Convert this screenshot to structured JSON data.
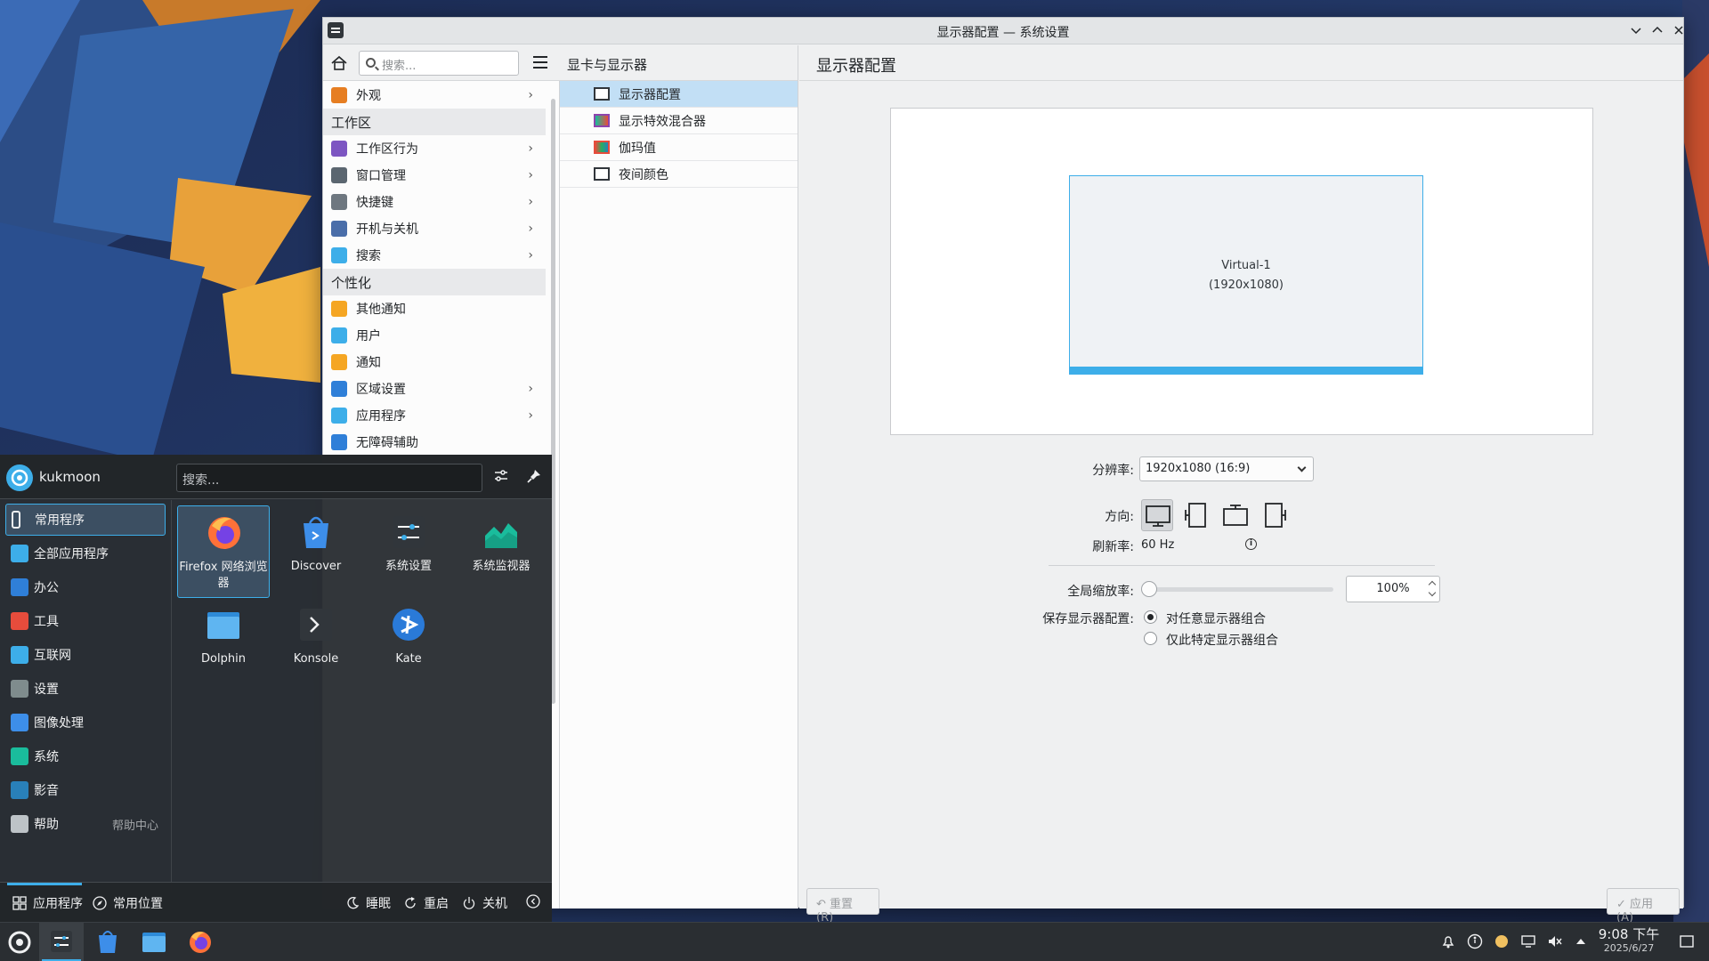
{
  "window": {
    "title": "显示器配置 — 系统设置",
    "search_placeholder": "搜索...",
    "sidebar": {
      "items": [
        {
          "type": "item",
          "label": "外观",
          "chevron": true,
          "color": "#e67e22"
        },
        {
          "type": "section",
          "label": "工作区"
        },
        {
          "type": "item",
          "label": "工作区行为",
          "chevron": true,
          "color": "#7d56c2"
        },
        {
          "type": "item",
          "label": "窗口管理",
          "chevron": true,
          "color": "#5b6670"
        },
        {
          "type": "item",
          "label": "快捷键",
          "chevron": true,
          "color": "#6e7780"
        },
        {
          "type": "item",
          "label": "开机与关机",
          "chevron": true,
          "color": "#4a6ea9"
        },
        {
          "type": "item",
          "label": "搜索",
          "chevron": true,
          "color": "#3daee9"
        },
        {
          "type": "section",
          "label": "个性化"
        },
        {
          "type": "item",
          "label": "其他通知",
          "chevron": false,
          "color": "#f5a623"
        },
        {
          "type": "item",
          "label": "用户",
          "chevron": false,
          "color": "#3daee9"
        },
        {
          "type": "item",
          "label": "通知",
          "chevron": false,
          "color": "#f5a623"
        },
        {
          "type": "item",
          "label": "区域设置",
          "chevron": true,
          "color": "#2f7fd8"
        },
        {
          "type": "item",
          "label": "应用程序",
          "chevron": true,
          "color": "#3daee9"
        },
        {
          "type": "item",
          "label": "无障碍辅助",
          "chevron": false,
          "color": "#2f7fd8"
        }
      ]
    },
    "sub": {
      "header": "显卡与显示器",
      "items": [
        {
          "label": "显示器配置",
          "active": true
        },
        {
          "label": "显示特效混合器",
          "active": false
        },
        {
          "label": "伽玛值",
          "active": false
        },
        {
          "label": "夜间颜色",
          "active": false
        }
      ]
    },
    "content": {
      "header": "显示器配置",
      "monitor_name": "Virtual-1",
      "monitor_res": "(1920x1080)",
      "resolution_label": "分辨率:",
      "resolution_value": "1920x1080 (16:9)",
      "orientation_label": "方向:",
      "refresh_label": "刷新率:",
      "refresh_value": "60 Hz",
      "scale_label": "全局缩放率:",
      "scale_value": "100%",
      "scale_level": 0,
      "save_label": "保存显示器配置:",
      "save_options": [
        {
          "label": "对任意显示器组合",
          "checked": true
        },
        {
          "label": "仅此特定显示器组合",
          "checked": false
        }
      ],
      "reset_button": "重置(R)",
      "apply_button": "应用(A)"
    }
  },
  "launcher": {
    "username": "kukmoon",
    "search_placeholder": "搜索...",
    "categories": [
      {
        "label": "常用程序",
        "active": true,
        "icon": "bookmark-icon"
      },
      {
        "label": "全部应用程序",
        "active": false,
        "icon": "grid-icon"
      },
      {
        "label": "办公",
        "active": false,
        "icon": "office-icon"
      },
      {
        "label": "工具",
        "active": false,
        "icon": "toolbox-icon"
      },
      {
        "label": "互联网",
        "active": false,
        "icon": "globe-icon"
      },
      {
        "label": "设置",
        "active": false,
        "icon": "settings-icon"
      },
      {
        "label": "图像处理",
        "active": false,
        "icon": "graphics-icon"
      },
      {
        "label": "系统",
        "active": false,
        "icon": "system-icon"
      },
      {
        "label": "影音",
        "active": false,
        "icon": "multimedia-icon"
      },
      {
        "label": "帮助",
        "active": false,
        "icon": "help-icon",
        "extra": "帮助中心"
      }
    ],
    "apps": [
      {
        "label": "Firefox 网络浏览器",
        "icon": "firefox-icon",
        "active": true
      },
      {
        "label": "Discover",
        "icon": "discover-icon",
        "active": false
      },
      {
        "label": "系统设置",
        "icon": "system-settings-icon",
        "active": false
      },
      {
        "label": "系统监视器",
        "icon": "system-monitor-icon",
        "active": false
      },
      {
        "label": "Dolphin",
        "icon": "dolphin-icon",
        "active": false
      },
      {
        "label": "Konsole",
        "icon": "konsole-icon",
        "active": false
      },
      {
        "label": "Kate",
        "icon": "kate-icon",
        "active": false
      }
    ],
    "footer": {
      "tab_apps": "应用程序",
      "tab_places": "常用位置",
      "sleep": "睡眠",
      "restart": "重启",
      "shutdown": "关机"
    }
  },
  "taskbar": {
    "time": "9:08 下午",
    "date": "2025/6/27"
  },
  "colors": {
    "accent": "#3daee9",
    "window_bg": "#eff0f1",
    "launcher_bg": "#2a2e32"
  }
}
